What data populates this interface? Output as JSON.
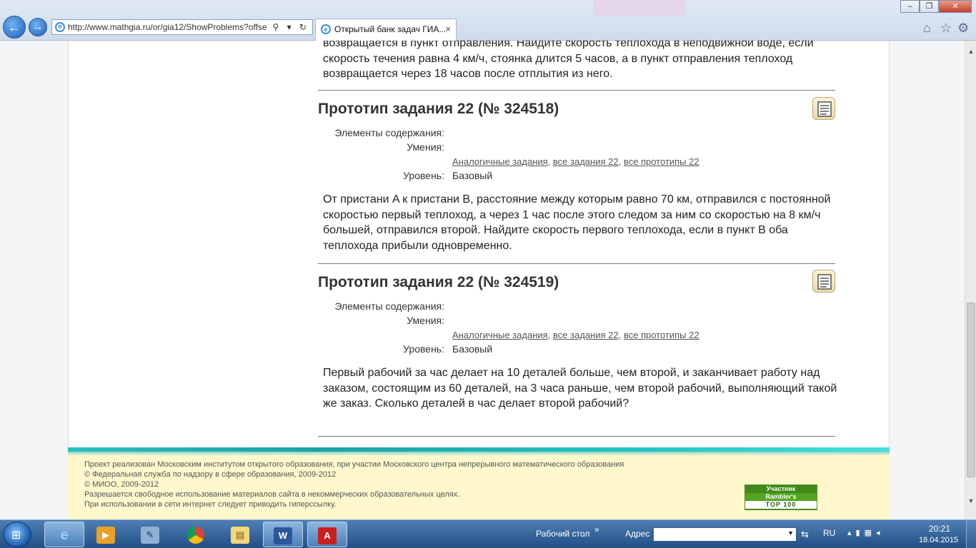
{
  "browser": {
    "address": "http://www.mathgia.ru/or/gia12/ShowProblems?offse",
    "tab_title": "Открытый банк задач ГИА...",
    "tab_close": "×",
    "nav_back": "←",
    "nav_forward": "→",
    "address_icons": "⚲ ▾ ↻",
    "min": "–",
    "max": "❐",
    "close": "✕",
    "home_icon": "⌂",
    "star_icon": "☆",
    "gear_icon": "⚙"
  },
  "page": {
    "top_problem_text": "возвращается в пункт отправления. Найдите скорость теплохода в неподвижной воде, если скорость течения равна 4 км/ч, стоянка длится 5 часов, а в пункт отправления теплоход возвращается через 18 часов после отплытия из него.",
    "problems": [
      {
        "title": "Прототип задания 22 (№ 324518)",
        "label_elements": "Элементы содержания:",
        "label_skills": "Умения:",
        "link_similar": "Аналогичные задания",
        "link_all_tasks": "все задания 22",
        "link_all_prototypes": "все прототипы 22",
        "label_level": "Уровень:",
        "level": "Базовый",
        "text": "От пристани A к пристани B, расстояние между которым равно 70 км, отправился с постоянной скоростью первый теплоход, а через 1 час после этого следом за ним со скоростью на 8 км/ч большей, отправился второй. Найдите скорость первого теплохода, если в пункт B оба теплохода прибыли одновременно."
      },
      {
        "title": "Прототип задания 22 (№ 324519)",
        "label_elements": "Элементы содержания:",
        "label_skills": "Умения:",
        "link_similar": "Аналогичные задания",
        "link_all_tasks": "все задания 22",
        "link_all_prototypes": "все прототипы 22",
        "label_level": "Уровень:",
        "level": "Базовый",
        "text": "Первый рабочий за час делает на 10 деталей больше, чем второй, и заканчивает работу над заказом, состоящим из 60 деталей, на 3 часа раньше, чем второй рабочий, выполняющий такой же заказ. Сколько деталей в час делает второй рабочий?"
      }
    ],
    "link_separator": ","
  },
  "footer": {
    "lines": [
      "Проект реализован Московским институтом открытого образования, при участии Московского центра непрерывного математического образования",
      "© Федеральная служба по надзору в сфере образования, 2009-2012",
      "© МИОО, 2009-2012",
      "Разрешается свободное использование материалов сайта в некоммерческих образовательных целях.",
      "При использовании в сети интернет следует приводить гиперссылку."
    ],
    "rambler": [
      "Участник",
      "Rambler's",
      "TOP 100"
    ]
  },
  "taskbar": {
    "desktop_label": "Рабочий стол",
    "address_label": "Адрес",
    "address_value": "",
    "lang": "RU",
    "time": "20:21",
    "date": "18.04.2015",
    "chevron": "»"
  },
  "colors": {
    "footer_bg": "#fff8cc",
    "footer_band": "#1aa3a4",
    "taskbar": "#2d5f96"
  }
}
